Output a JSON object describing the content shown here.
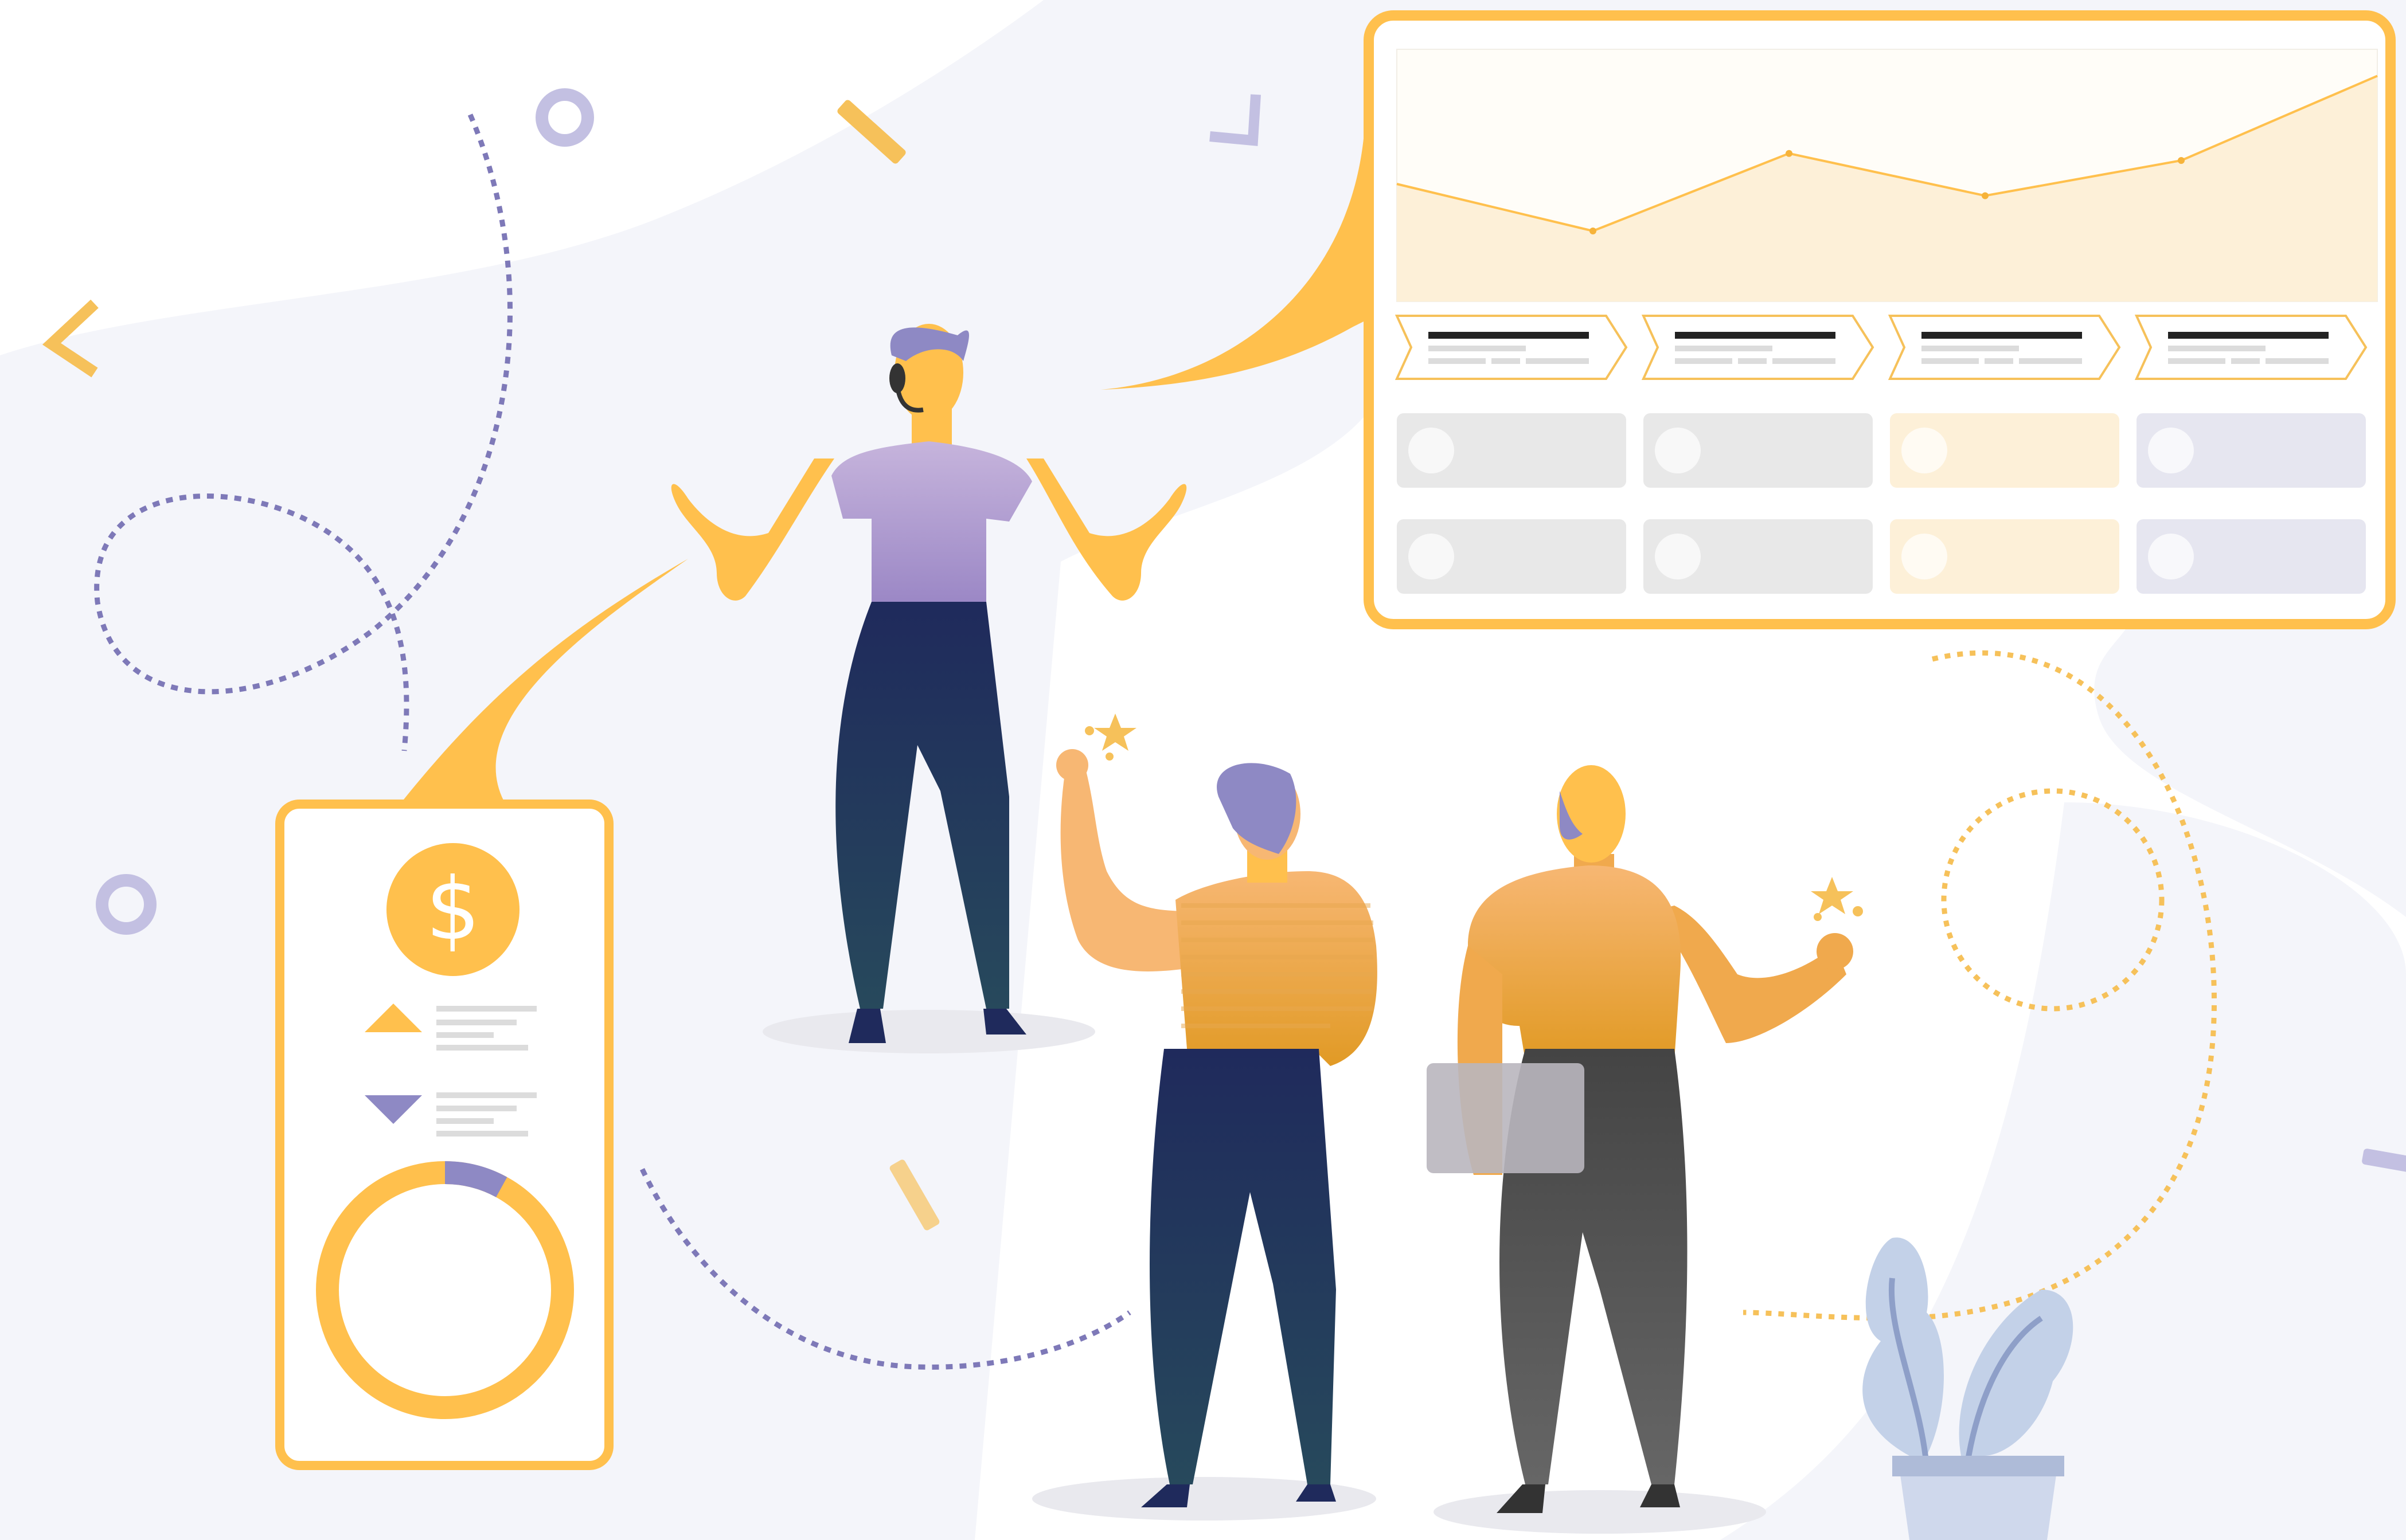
{
  "scene": "business-analytics-illustration",
  "palette": {
    "accent": "#ffc04d",
    "accent_light": "#fdf0d8",
    "purple": "#8e89c4",
    "navy": "#1f2a5c",
    "gray": "#4a4a4a",
    "blob": "#f4f5fa"
  },
  "phone": {
    "currency_symbol": "$",
    "up_icon": "triangle-up-icon",
    "down_icon": "triangle-down-icon",
    "donut_share": 0.08
  },
  "dashboard": {
    "line_chart_points": [
      0.5,
      0.3,
      0.63,
      0.45,
      0.6,
      0.96
    ],
    "step_cards": 4,
    "tile_rows": 2
  }
}
